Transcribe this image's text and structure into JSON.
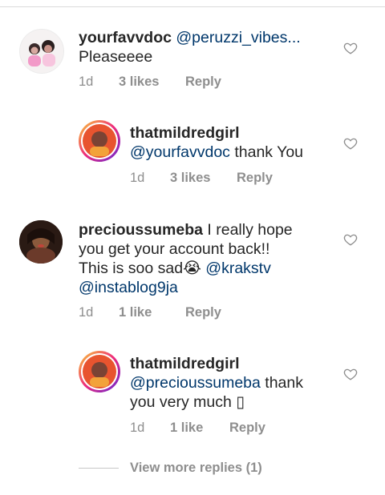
{
  "comments": [
    {
      "username": "yourfavvdoc",
      "mention": "@peruzzi_vibes...",
      "text": "Pleaseeee",
      "time": "1d",
      "likes": "3 likes",
      "reply": "Reply"
    },
    {
      "username": "thatmildredgirl",
      "mention": "@yourfavvdoc",
      "text": " thank You",
      "time": "1d",
      "likes": "3 likes",
      "reply": "Reply"
    },
    {
      "username": "precioussumeba",
      "text_line1": " I really hope",
      "text_line2": "you get your account back!!",
      "text_line3": "This is soo sad",
      "emoji": "😭",
      "mention1": " @krakstv",
      "mention2": "@instablog9ja",
      "time": "1d",
      "likes": "1 like",
      "reply": "Reply"
    },
    {
      "username": "thatmildredgirl",
      "mention": "@precioussumeba",
      "text_line1": " thank",
      "text_line2": "you very much",
      "glyph": "▯",
      "time": "1d",
      "likes": "1 like",
      "reply": "Reply"
    }
  ],
  "view_more": "View more replies (1)",
  "colors": {
    "mention": "#00376b",
    "meta": "#8e8e8e",
    "text": "#262626"
  },
  "icons": [
    "heart-icon"
  ]
}
